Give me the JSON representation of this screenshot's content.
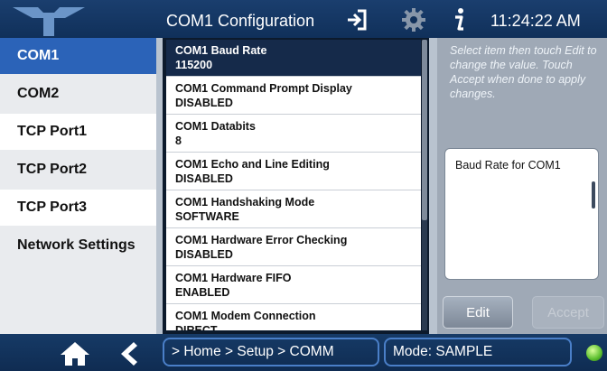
{
  "header": {
    "title": "COM1 Configuration",
    "icons": [
      "logo-icon",
      "exit-icon",
      "gear-icon",
      "info-icon"
    ],
    "time": "11:24:22 AM"
  },
  "sidebar": {
    "items": [
      {
        "label": "COM1",
        "active": true
      },
      {
        "label": "COM2",
        "active": false
      },
      {
        "label": "TCP Port1",
        "active": false
      },
      {
        "label": "TCP Port2",
        "active": false
      },
      {
        "label": "TCP Port3",
        "active": false
      },
      {
        "label": "Network Settings",
        "active": false
      }
    ]
  },
  "settings": {
    "rows": [
      {
        "name": "COM1 Baud Rate",
        "value": "115200",
        "selected": true
      },
      {
        "name": "COM1 Command Prompt Display",
        "value": "DISABLED",
        "selected": false
      },
      {
        "name": "COM1 Databits",
        "value": "8",
        "selected": false
      },
      {
        "name": "COM1 Echo and Line Editing",
        "value": "DISABLED",
        "selected": false
      },
      {
        "name": "COM1 Handshaking Mode",
        "value": "SOFTWARE",
        "selected": false
      },
      {
        "name": "COM1 Hardware Error Checking",
        "value": "DISABLED",
        "selected": false
      },
      {
        "name": "COM1 Hardware FIFO",
        "value": "ENABLED",
        "selected": false
      },
      {
        "name": "COM1 Modem Connection",
        "value": "DIRECT",
        "selected": false
      }
    ]
  },
  "help": {
    "instructions": "Select item then touch Edit to change the value. Touch Accept when done to apply changes.",
    "description": "Baud Rate for COM1"
  },
  "buttons": {
    "edit": "Edit",
    "accept": "Accept"
  },
  "footer": {
    "breadcrumb": "> Home > Setup > COMM",
    "mode": "Mode: SAMPLE",
    "icons": [
      "home-icon",
      "back-icon",
      "status-led-icon"
    ]
  },
  "colors": {
    "header_bg": "#10305a",
    "selected_nav": "#2b63b8",
    "selected_row": "#152a4a",
    "status_led": "#5bbf2e"
  }
}
